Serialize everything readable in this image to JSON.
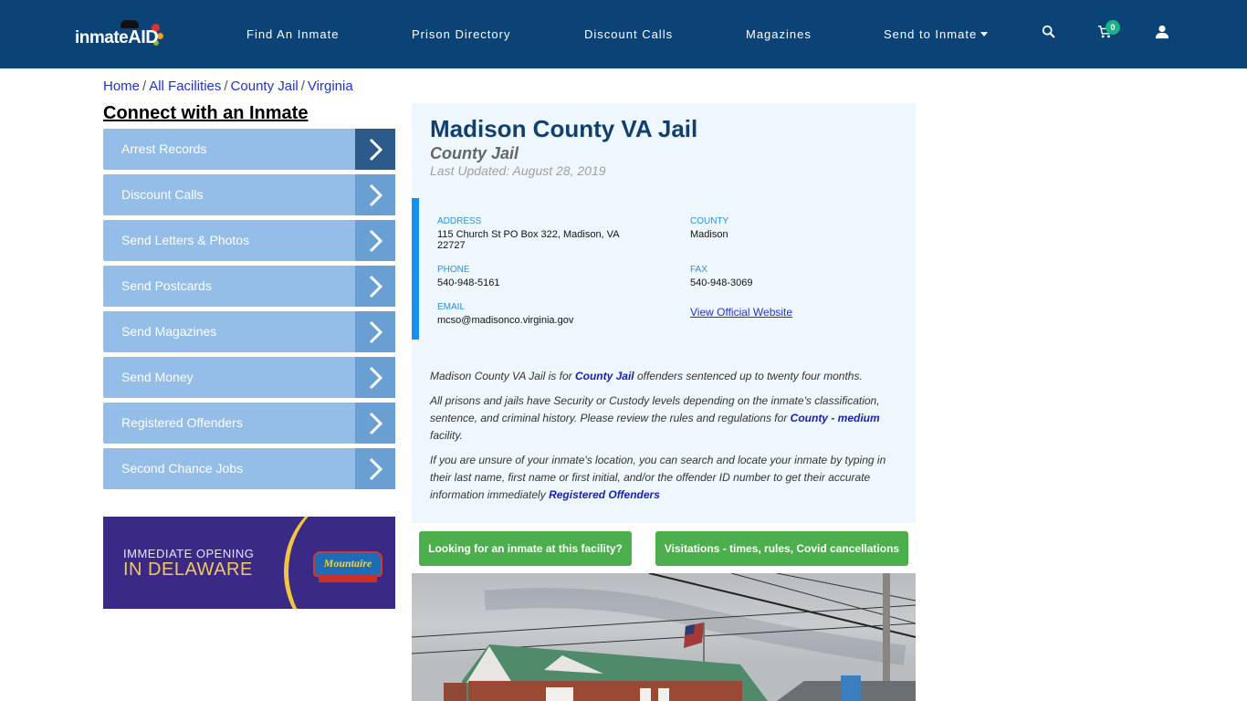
{
  "header": {
    "logo": {
      "text_main": "inmate",
      "text_accent": "AID"
    },
    "nav": [
      {
        "label": "Find An Inmate"
      },
      {
        "label": "Prison Directory"
      },
      {
        "label": "Discount Calls"
      },
      {
        "label": "Magazines"
      },
      {
        "label": "Send to Inmate",
        "has_dropdown": true
      }
    ],
    "icons": {
      "search": "search-icon",
      "cart": "cart-icon",
      "user": "user-icon"
    },
    "cart_count": "0"
  },
  "breadcrumb": [
    "Home",
    "All Facilities",
    "County Jail",
    "Virginia"
  ],
  "sidebar": {
    "title": "Connect with an Inmate",
    "items": [
      {
        "label": "Arrest Records",
        "active": true
      },
      {
        "label": "Discount Calls"
      },
      {
        "label": "Send Letters & Photos"
      },
      {
        "label": "Send Postcards"
      },
      {
        "label": "Send Magazines"
      },
      {
        "label": "Send Money"
      },
      {
        "label": "Registered Offenders"
      },
      {
        "label": "Second Chance Jobs"
      }
    ],
    "ad": {
      "line1": "IMMEDIATE OPENING",
      "line2": "IN DELAWARE",
      "brand": "Mountaire"
    }
  },
  "facility": {
    "name": "Madison County VA Jail",
    "type": "County Jail",
    "last_updated": "Last Updated: August 28, 2019",
    "address_label": "ADDRESS",
    "address": "115 Church St PO Box 322, Madison, VA 22727",
    "county_label": "COUNTY",
    "county": "Madison",
    "phone_label": "PHONE",
    "phone": "540-948-5161",
    "fax_label": "FAX",
    "fax": "540-948-3069",
    "email_label": "EMAIL",
    "email": "mcso@madisonco.virginia.gov",
    "website_link": "View Official Website"
  },
  "description": {
    "p1_pre": "Madison County VA Jail is for ",
    "p1_link": "County Jail",
    "p1_post": " offenders sentenced up to twenty four months.",
    "p2_pre": "All prisons and jails have Security or Custody levels depending on the inmate's classification, sentence, and criminal history. Please review the rules and regulations for ",
    "p2_link": "County - medium",
    "p2_post": " facility.",
    "p3_pre": "If you are unsure of your inmate's location, you can search and locate your inmate by typing in their last name, first name or first initial, and/or the offender ID number to get their accurate information immediately ",
    "p3_link": "Registered Offenders"
  },
  "buttons": {
    "find_inmate": "Looking for an inmate at this facility?",
    "visitations": "Visitations - times, rules, Covid cancellations"
  },
  "colors": {
    "navbar": "#0b4377",
    "sidebar_item": "#94bde8",
    "sidebar_arrow": "#6a9fd3",
    "sidebar_arrow_active": "#2b5a8b",
    "card_bg": "#eef7fd",
    "accent_bar": "#1690f0",
    "green_button": "#4cae4c",
    "badge": "#1bb386"
  }
}
